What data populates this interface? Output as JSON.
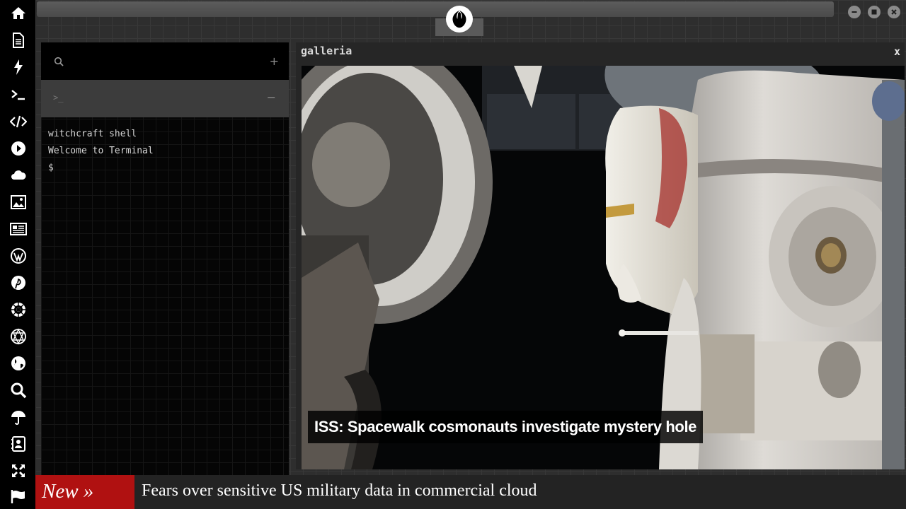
{
  "sidebar": {
    "items": [
      {
        "icon": "home-icon"
      },
      {
        "icon": "document-icon"
      },
      {
        "icon": "lightning-icon"
      },
      {
        "icon": "terminal-icon"
      },
      {
        "icon": "code-icon"
      },
      {
        "icon": "play-icon"
      },
      {
        "icon": "cloud-icon"
      },
      {
        "icon": "image-icon"
      },
      {
        "icon": "newspaper-icon"
      },
      {
        "icon": "wordpress-icon"
      },
      {
        "icon": "pinterest-icon"
      },
      {
        "icon": "galactic-empire-icon"
      },
      {
        "icon": "geodesic-icon"
      },
      {
        "icon": "globe-icon"
      },
      {
        "icon": "search-icon"
      },
      {
        "icon": "umbrella-icon"
      },
      {
        "icon": "contacts-icon"
      },
      {
        "icon": "expand-icon"
      },
      {
        "icon": "flag-icon"
      }
    ]
  },
  "titlebar": {
    "logo_icon": "rebel-alliance-icon",
    "buttons": [
      "minimize-icon",
      "maximize-icon",
      "close-icon"
    ]
  },
  "terminal": {
    "search_icon": "search-icon",
    "add_label": "+",
    "tab_prompt": ">_",
    "minimize_label": "−",
    "lines": [
      "witchcraft shell",
      "Welcome to Terminal",
      "$"
    ]
  },
  "galleria": {
    "title": "galleria",
    "close_label": "x",
    "caption": "ISS: Spacewalk cosmonauts investigate mystery hole"
  },
  "ticker": {
    "label": "New »",
    "headline": "Fears over sensitive US military data in commercial cloud"
  },
  "colors": {
    "ticker_label_bg": "#b01111",
    "desktop_bg": "#2e2e2e",
    "terminal_bg": "#050505"
  }
}
